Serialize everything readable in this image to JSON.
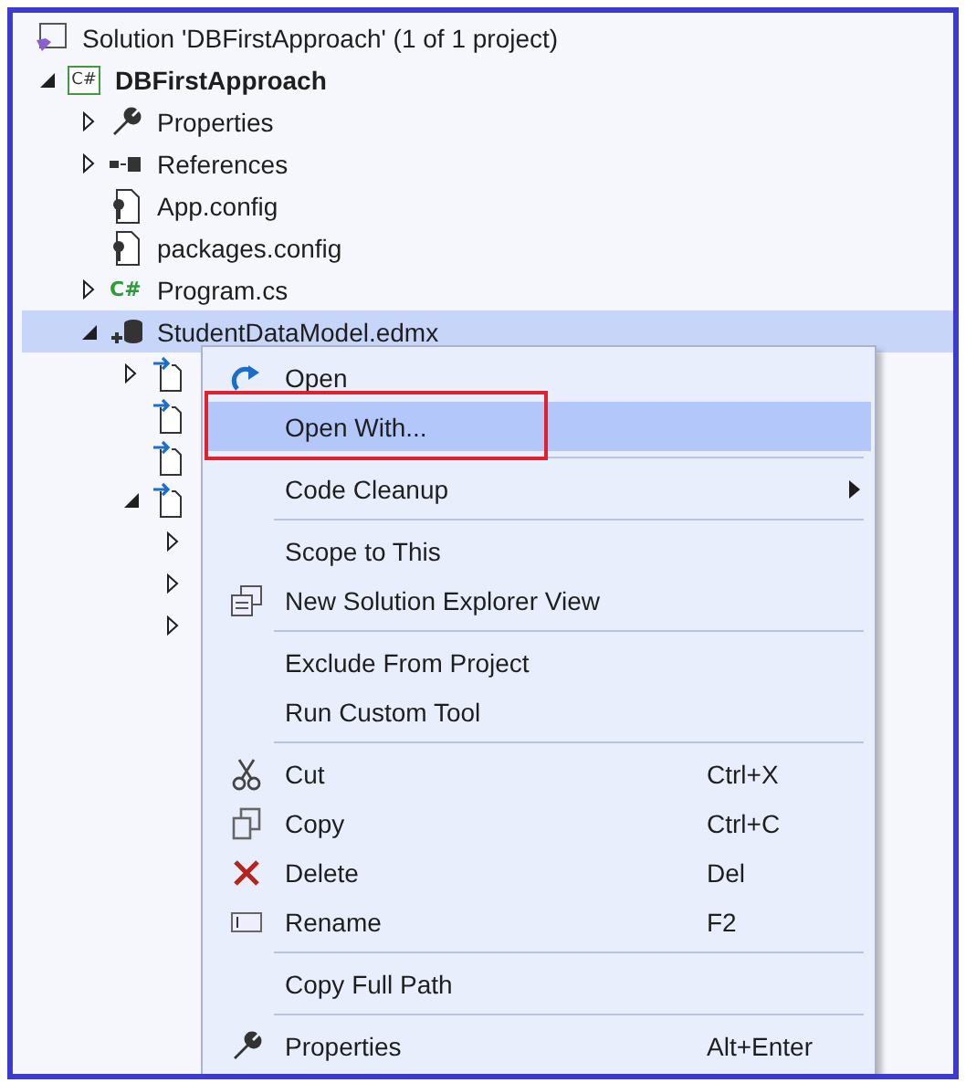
{
  "tree": [
    {
      "label": "Solution 'DBFirstApproach' (1 of 1 project)",
      "kind": "solution",
      "bold": false,
      "selected": false,
      "children": [
        {
          "label": "DBFirstApproach",
          "kind": "project",
          "badge": "C#",
          "bold": true,
          "selected": false,
          "expanded": true,
          "expandable": true,
          "children": [
            {
              "label": "Properties",
              "kind": "properties",
              "bold": false,
              "selected": false,
              "expanded": false,
              "expandable": true
            },
            {
              "label": "References",
              "kind": "references",
              "bold": false,
              "selected": false,
              "expanded": false,
              "expandable": true
            },
            {
              "label": "App.config",
              "kind": "config",
              "bold": false,
              "selected": false,
              "expandable": false
            },
            {
              "label": "packages.config",
              "kind": "config",
              "bold": false,
              "selected": false,
              "expandable": false
            },
            {
              "label": "Program.cs",
              "kind": "source",
              "badge": "C#",
              "bold": false,
              "selected": false,
              "expanded": false,
              "expandable": true
            },
            {
              "label": "StudentDataModel.edmx",
              "kind": "model",
              "bold": false,
              "selected": true,
              "expanded": true,
              "expandable": true,
              "children": [
                {
                  "kind": "file",
                  "selected": false,
                  "expanded": false,
                  "expandable": true
                },
                {
                  "kind": "file",
                  "selected": false,
                  "expandable": false
                },
                {
                  "kind": "file",
                  "selected": false,
                  "expandable": false
                },
                {
                  "kind": "file",
                  "selected": false,
                  "expanded": true,
                  "expandable": true,
                  "children": [
                    {
                      "selected": false,
                      "expanded": false,
                      "expandable": true
                    },
                    {
                      "selected": false,
                      "expanded": false,
                      "expandable": true
                    },
                    {
                      "selected": false,
                      "expanded": false,
                      "expandable": true
                    }
                  ]
                }
              ]
            }
          ]
        }
      ]
    }
  ],
  "context_menu": {
    "items": [
      {
        "kind": "item",
        "label": "Open",
        "selected": false,
        "marked": false
      },
      {
        "kind": "item",
        "label": "Open With...",
        "selected": true,
        "marked": true
      },
      {
        "kind": "separator"
      },
      {
        "kind": "item",
        "label": "Code Cleanup",
        "submenu": true,
        "selected": false,
        "marked": false
      },
      {
        "kind": "separator"
      },
      {
        "kind": "item",
        "label": "Scope to This",
        "selected": false,
        "marked": false
      },
      {
        "kind": "item",
        "label": "New Solution Explorer View",
        "selected": false,
        "marked": false
      },
      {
        "kind": "separator"
      },
      {
        "kind": "item",
        "label": "Exclude From Project",
        "selected": false,
        "marked": false
      },
      {
        "kind": "item",
        "label": "Run Custom Tool",
        "selected": false,
        "marked": false
      },
      {
        "kind": "separator"
      },
      {
        "kind": "item",
        "label": "Cut",
        "shortcut": "Ctrl+X",
        "selected": false,
        "marked": false
      },
      {
        "kind": "item",
        "label": "Copy",
        "shortcut": "Ctrl+C",
        "selected": false,
        "marked": false
      },
      {
        "kind": "item",
        "label": "Delete",
        "shortcut": "Del",
        "selected": false,
        "marked": false
      },
      {
        "kind": "item",
        "label": "Rename",
        "shortcut": "F2",
        "selected": false,
        "marked": false
      },
      {
        "kind": "separator"
      },
      {
        "kind": "item",
        "label": "Copy Full Path",
        "selected": false,
        "marked": false
      },
      {
        "kind": "separator"
      },
      {
        "kind": "item",
        "label": "Properties",
        "shortcut": "Alt+Enter",
        "selected": false,
        "marked": false
      }
    ]
  }
}
